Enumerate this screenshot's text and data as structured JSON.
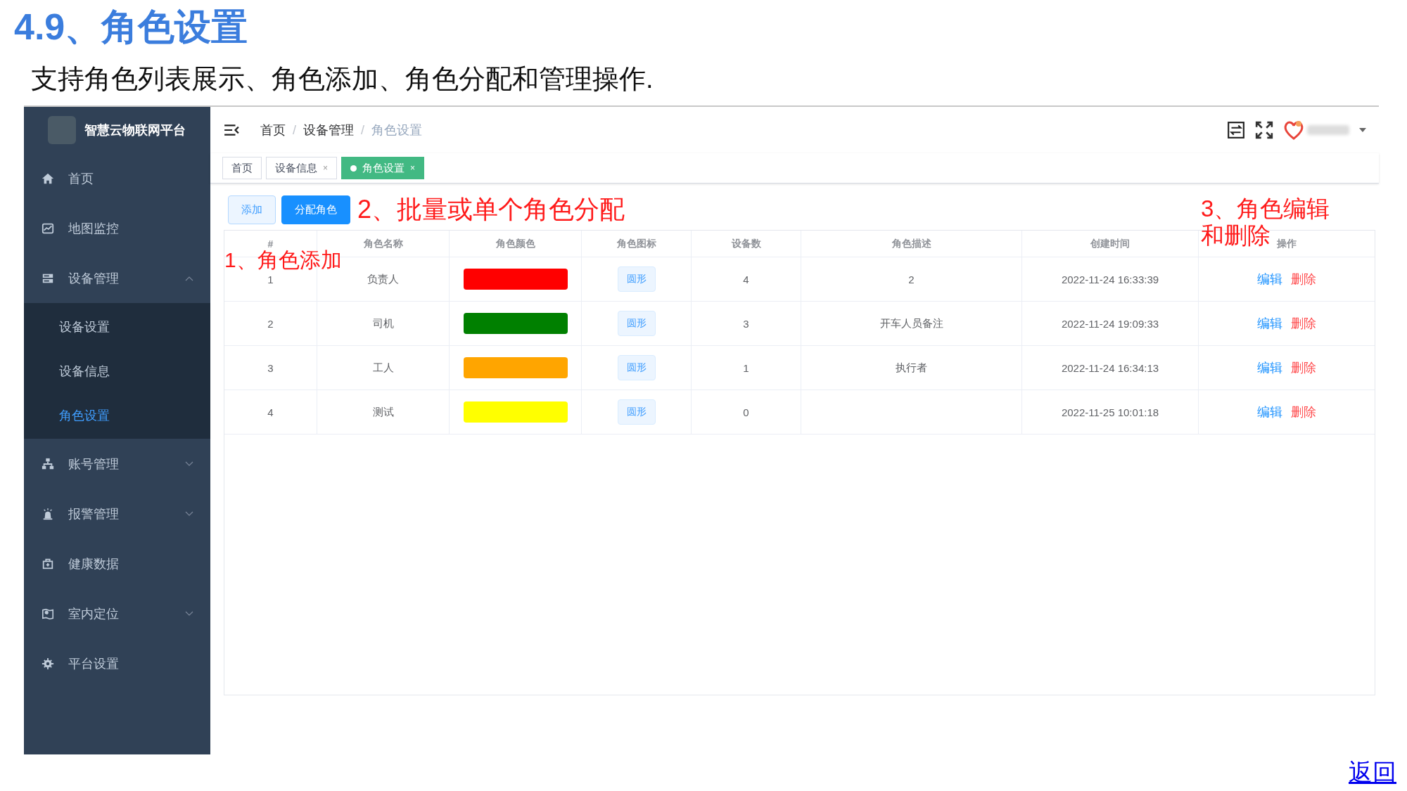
{
  "page_title": "4.9、角色设置",
  "subtitle": "支持角色列表展示、角色添加、角色分配和管理操作.",
  "app": {
    "brand": "智慧云物联网平台",
    "sidebar": {
      "items": [
        {
          "label": "首页",
          "selected": false,
          "expandable": false
        },
        {
          "label": "地图监控",
          "selected": false,
          "expandable": false
        },
        {
          "label": "设备管理",
          "selected": false,
          "expandable": true,
          "expanded": true,
          "children": [
            {
              "label": "设备设置",
              "selected": false
            },
            {
              "label": "设备信息",
              "selected": false
            },
            {
              "label": "角色设置",
              "selected": true
            }
          ]
        },
        {
          "label": "账号管理",
          "selected": false,
          "expandable": true,
          "expanded": false
        },
        {
          "label": "报警管理",
          "selected": false,
          "expandable": true,
          "expanded": false
        },
        {
          "label": "健康数据",
          "selected": false,
          "expandable": false
        },
        {
          "label": "室内定位",
          "selected": false,
          "expandable": true,
          "expanded": false
        },
        {
          "label": "平台设置",
          "selected": false,
          "expandable": false
        }
      ]
    },
    "breadcrumb": [
      {
        "label": "首页",
        "current": false
      },
      {
        "label": "设备管理",
        "current": false
      },
      {
        "label": "角色设置",
        "current": true
      }
    ],
    "breadcrumb_separator": "/",
    "tabs": [
      {
        "label": "首页",
        "selected": false,
        "closable": false
      },
      {
        "label": "设备信息",
        "selected": false,
        "closable": true
      },
      {
        "label": "角色设置",
        "selected": true,
        "closable": true
      }
    ],
    "close_mark": "×",
    "toolbar": {
      "buttons": [
        {
          "label": "添加",
          "kind": "plain"
        },
        {
          "label": "分配角色",
          "kind": "primary"
        }
      ]
    },
    "table": {
      "columns": [
        "#",
        "角色名称",
        "角色颜色",
        "角色图标",
        "设备数",
        "角色描述",
        "创建时间",
        "操作"
      ],
      "rows": [
        {
          "index": "1",
          "name": "负责人",
          "color": "#ff0000",
          "icon_label": "圆形",
          "device_count": "4",
          "description": "2",
          "created": "2022-11-24 16:33:39",
          "actions": [
            {
              "label": "编辑",
              "kind": "edit"
            },
            {
              "label": "删除",
              "kind": "delete"
            }
          ]
        },
        {
          "index": "2",
          "name": "司机",
          "color": "#008000",
          "icon_label": "圆形",
          "device_count": "3",
          "description": "开车人员备注",
          "created": "2022-11-24 19:09:33",
          "actions": [
            {
              "label": "编辑",
              "kind": "edit"
            },
            {
              "label": "删除",
              "kind": "delete"
            }
          ]
        },
        {
          "index": "3",
          "name": "工人",
          "color": "#ffa500",
          "icon_label": "圆形",
          "device_count": "1",
          "description": "执行者",
          "created": "2022-11-24 16:34:13",
          "actions": [
            {
              "label": "编辑",
              "kind": "edit"
            },
            {
              "label": "删除",
              "kind": "delete"
            }
          ]
        },
        {
          "index": "4",
          "name": "测试",
          "color": "#ffff00",
          "icon_label": "圆形",
          "device_count": "0",
          "created": "2022-11-25 10:01:18",
          "actions": [
            {
              "label": "编辑",
              "kind": "edit"
            },
            {
              "label": "删除",
              "kind": "delete"
            }
          ]
        }
      ]
    },
    "annotations": [
      {
        "text": "1、角色添加"
      },
      {
        "text": "2、批量或单个角色分配"
      },
      {
        "lines": [
          "3、角色编辑",
          "和删除"
        ]
      }
    ]
  },
  "return_link": "返回"
}
